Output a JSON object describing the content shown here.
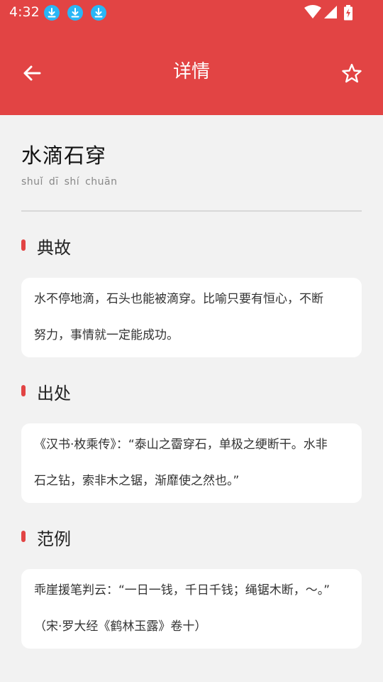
{
  "status_bar": {
    "time": "4:32",
    "notification_icons": [
      "download-icon",
      "download-icon",
      "download-icon"
    ],
    "right_icons": [
      "wifi-icon",
      "signal-icon",
      "battery-charging-icon"
    ]
  },
  "app_bar": {
    "title": "详情",
    "back_icon": "arrow-left-icon",
    "favorite_icon": "star-outline-icon",
    "background_color": "#e24444"
  },
  "idiom": {
    "text": "水滴石穿",
    "pinyin": "shuǐ dī shí chuān"
  },
  "sections": [
    {
      "title": "典故",
      "lines": [
        "水不停地滴，石头也能被滴穿。比喻只要有恒心，不断",
        "努力，事情就一定能成功。"
      ]
    },
    {
      "title": "出处",
      "lines": [
        "《汉书·枚乘传》：“泰山之霤穿石，单极之绠断干。水非",
        "石之钻，索非木之锯，渐靡使之然也。”"
      ]
    },
    {
      "title": "范例",
      "lines": [
        "乖崖援笔判云：“一日一钱，千日千钱；绳锯木断，～。”",
        "（宋·罗大经《鹤林玉露》卷十）"
      ]
    }
  ],
  "colors": {
    "accent": "#e24444",
    "page_background": "#f2f2f2",
    "card_background": "#ffffff"
  }
}
